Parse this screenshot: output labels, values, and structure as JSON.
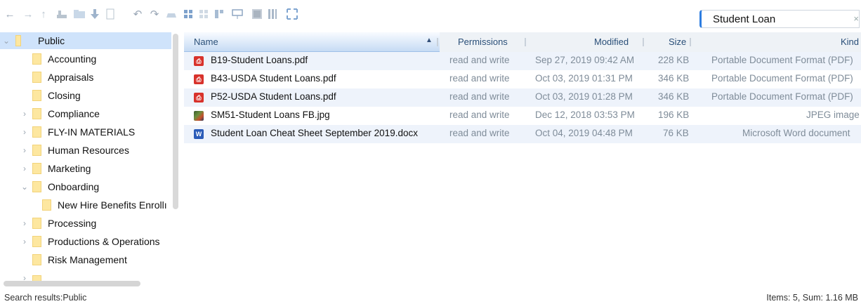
{
  "toolbar": {
    "icons": [
      "back-arrow-icon",
      "forward-arrow-icon",
      "up-arrow-icon",
      "server-icon",
      "folder-icon",
      "download-icon",
      "new-file-icon",
      "undo-icon",
      "redo-icon",
      "bucket-icon",
      "grid-view-icon",
      "grid-view-alt-icon",
      "split-view-icon",
      "monitor-icon",
      "texture-icon",
      "columns-icon",
      "expand-icon"
    ]
  },
  "search": {
    "value": "Student Loan",
    "clear": "×"
  },
  "tree": {
    "root": "Public",
    "items": [
      {
        "label": "Accounting"
      },
      {
        "label": "Appraisals"
      },
      {
        "label": "Closing"
      },
      {
        "label": "Compliance"
      },
      {
        "label": "FLY-IN MATERIALS"
      },
      {
        "label": "Human Resources"
      },
      {
        "label": "Marketing"
      },
      {
        "label": "Onboarding"
      },
      {
        "label": "New Hire Benefits Enrollı"
      },
      {
        "label": "Processing"
      },
      {
        "label": "Productions & Operations"
      },
      {
        "label": "Risk Management"
      }
    ]
  },
  "columns": {
    "name": "Name",
    "permissions": "Permissions",
    "modified": "Modified",
    "size": "Size",
    "kind": "Kind"
  },
  "files": [
    {
      "name": "B19-Student Loans.pdf",
      "icon": "pdf-icon",
      "permissions": "read and write",
      "modified": "Sep 27, 2019 09:42 AM",
      "size": "228 KB",
      "kind": "Portable Document Format (PDF)"
    },
    {
      "name": "B43-USDA Student Loans.pdf",
      "icon": "pdf-icon",
      "permissions": "read and write",
      "modified": "Oct 03, 2019 01:31 PM",
      "size": "346 KB",
      "kind": "Portable Document Format (PDF)"
    },
    {
      "name": "P52-USDA Student Loans.pdf",
      "icon": "pdf-icon",
      "permissions": "read and write",
      "modified": "Oct 03, 2019 01:28 PM",
      "size": "346 KB",
      "kind": "Portable Document Format (PDF)"
    },
    {
      "name": "SM51-Student Loans FB.jpg",
      "icon": "image-icon",
      "permissions": "read and write",
      "modified": "Dec 12, 2018 03:53 PM",
      "size": "196 KB",
      "kind": "JPEG image"
    },
    {
      "name": "Student Loan Cheat Sheet September 2019.docx",
      "icon": "word-icon",
      "permissions": "read and write",
      "modified": "Oct 04, 2019 04:48 PM",
      "size": "76 KB",
      "kind": "Microsoft Word document"
    }
  ],
  "status": {
    "left": "Search results:Public",
    "right": "Items: 5, Sum: 1.16 MB"
  }
}
